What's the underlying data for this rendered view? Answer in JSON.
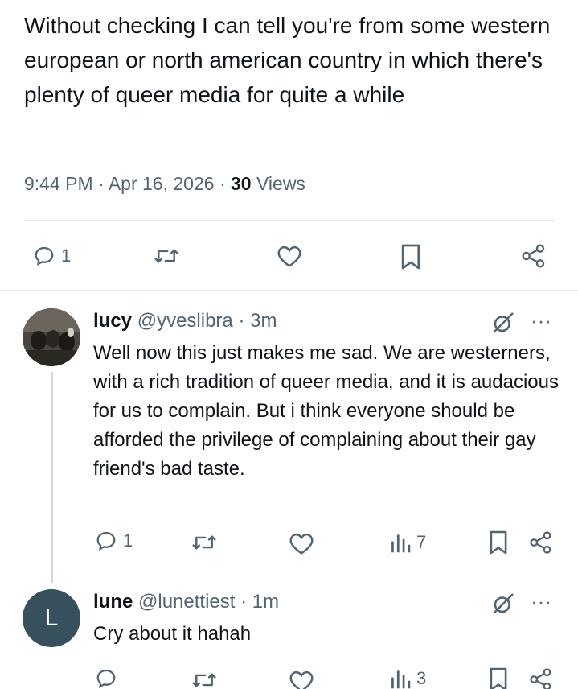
{
  "tweet": {
    "text": "Without checking I can tell you're from some western european or north american country in which there's plenty of queer media for quite a while",
    "time": "9:44 PM",
    "date": "Apr 16, 2026",
    "views_count": "30",
    "views_label": "Views",
    "reply_count": "1"
  },
  "replies": [
    {
      "name": "lucy",
      "handle": "@yveslibra",
      "age": "3m",
      "text": "Well now this just makes me sad.  We are westerners, with a rich tradition of queer media, and it is audacious for us to complain. But i think everyone should be afforded the privilege of complaining about their gay friend's bad taste.",
      "reply_count": "1",
      "views": "7"
    },
    {
      "name": "lune",
      "handle": "@lunettiest",
      "age": "1m",
      "avatar_letter": "L",
      "text": "Cry about it hahah",
      "views": "3"
    }
  ],
  "separator": "·",
  "more_label": "···",
  "colors": {
    "text": "#0f1419",
    "secondary": "#536471",
    "divider": "#e7e9ea",
    "avatar_l": "#37505e"
  },
  "icons": [
    "reply-icon",
    "retweet-icon",
    "like-icon",
    "bookmark-icon",
    "share-icon",
    "grok-icon",
    "views-icon",
    "more-icon"
  ]
}
